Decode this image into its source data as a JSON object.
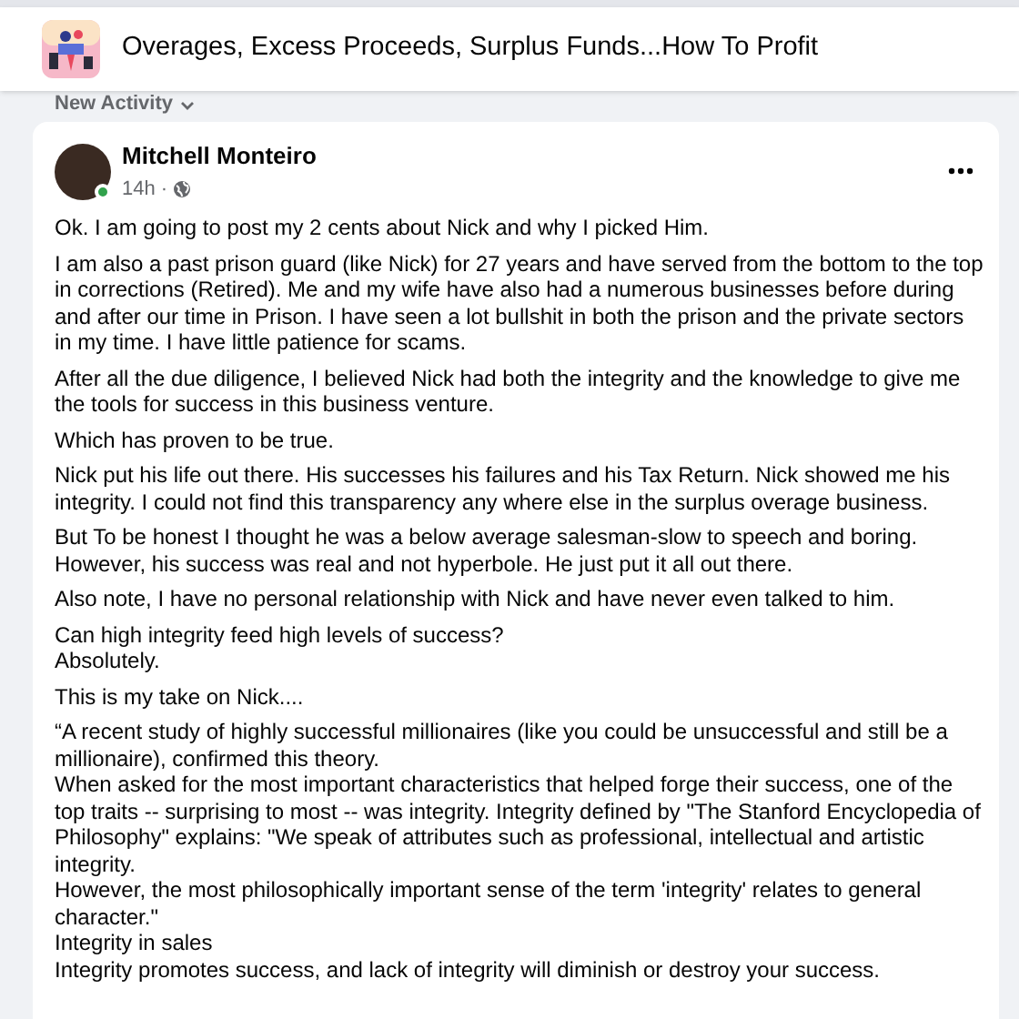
{
  "header": {
    "group_name": "Overages, Excess Proceeds, Surplus Funds...How To Profit"
  },
  "feed_sort": {
    "label": "New Activity"
  },
  "post": {
    "author": "Mitchell Monteiro",
    "online": true,
    "time": "14h ·",
    "paragraphs": [
      "Ok. I am going to post my 2 cents about Nick and why I picked Him.",
      "I am also a past prison guard (like Nick) for 27 years and have served from the bottom to the top in corrections (Retired). Me and my wife have also had a numerous businesses  before during and after our time in Prison. I have seen a lot bullshit in both the prison and the private sectors in my time. I have little patience for scams.",
      "After all the due diligence, I believed Nick had both the integrity and the knowledge to give me the tools for success in this business venture.",
      "Which has proven to be true.",
      "Nick put his life out there. His successes  his failures and his Tax Return.  Nick showed me his integrity. I could not find this transparency any where else in the surplus overage business.",
      "But To be honest I thought he was a below average salesman-slow to speech and boring. However, his success was real and not hyperbole. He just put it all out there.",
      "Also note, I have no personal relationship with Nick and have never even talked to him.",
      "Can high integrity feed high levels of success?\nAbsolutely.",
      "This is my take on Nick....",
      "“A recent study of highly successful millionaires (like you could be unsuccessful and still be a millionaire), confirmed this theory.\nWhen asked for the most important characteristics that helped forge their success, one of the top traits -- surprising to most -- was integrity. Integrity defined by \"The Stanford Encyclopedia of Philosophy\" explains: \"We speak of attributes such as professional, intellectual and artistic integrity.\nHowever, the most philosophically important sense of the term 'integrity' relates to general character.\"\nIntegrity in sales\nIntegrity promotes success, and lack of integrity will diminish or destroy your success."
    ]
  }
}
